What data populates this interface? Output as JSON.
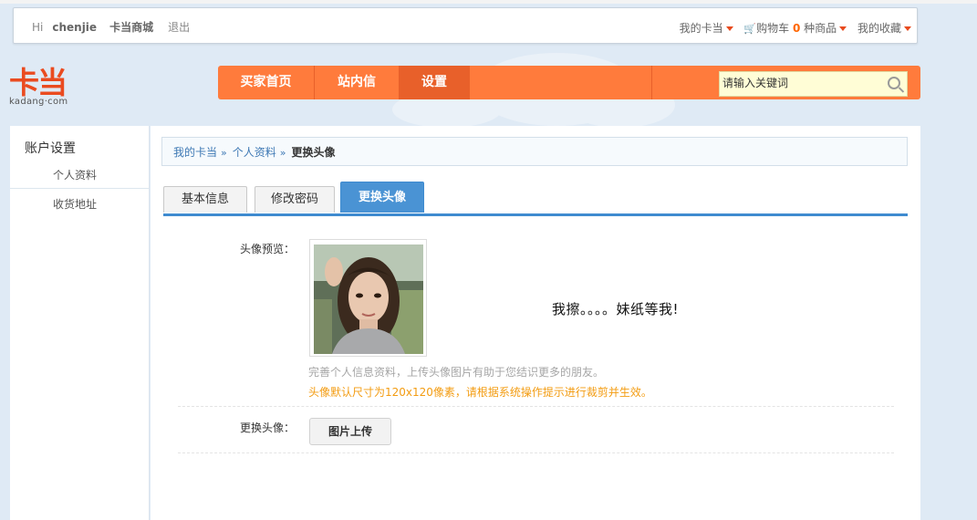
{
  "topbar": {
    "hi": "Hi",
    "username": "chenjie",
    "mall": "卡当商城",
    "logout": "退出",
    "my_kadang": "我的卡当",
    "cart_prefix": "购物车",
    "cart_count": "0",
    "cart_suffix": "种商品",
    "favorites": "我的收藏"
  },
  "logo": {
    "cn": "卡当",
    "en": "kadang·com"
  },
  "nav": {
    "items": [
      "买家首页",
      "站内信",
      "设置"
    ],
    "active": "设置",
    "search_placeholder": "请输入关键词"
  },
  "sidebar": {
    "title": "账户设置",
    "items": [
      "个人资料",
      "收货地址"
    ],
    "active": "个人资料"
  },
  "breadcrumb": {
    "items": [
      "我的卡当",
      "个人资料"
    ],
    "current": "更换头像",
    "separator": "»"
  },
  "tabs": {
    "items": [
      "基本信息",
      "修改密码",
      "更换头像"
    ],
    "active": "更换头像"
  },
  "avatar_section": {
    "preview_label": "头像预览：",
    "caption": "我擦。。。。妹纸等我!",
    "hint": "完善个人信息资料，上传头像图片有助于您结识更多的朋友。",
    "size_notice": "头像默认尺寸为120x120像素，请根据系统操作提示进行裁剪并生效。",
    "change_label": "更换头像：",
    "upload_button": "图片上传"
  },
  "colors": {
    "brand_orange": "#ff7b3c",
    "tab_active_blue": "#4a93d4",
    "link_blue": "#3d78b4",
    "notice_orange": "#f39c12",
    "logo_red": "#ea4b20"
  }
}
